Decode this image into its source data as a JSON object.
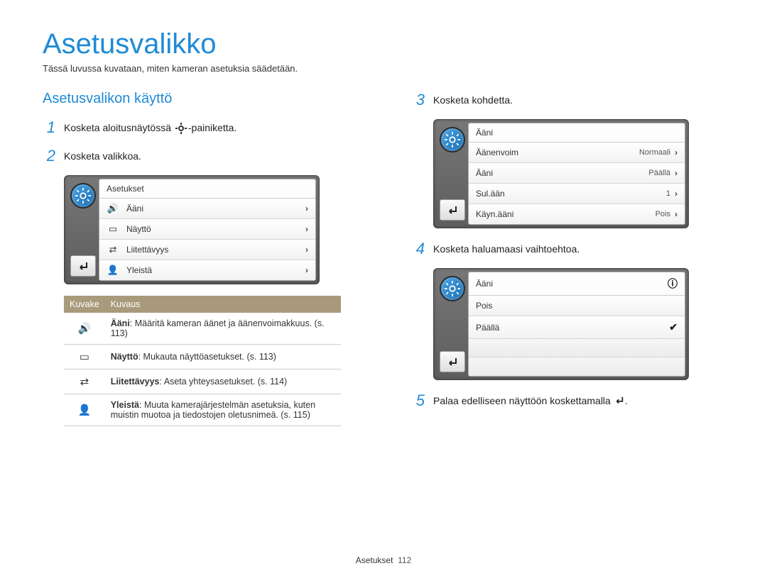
{
  "page": {
    "title": "Asetusvalikko",
    "subtitle": "Tässä luvussa kuvataan, miten kameran asetuksia säädetään."
  },
  "section_title": "Asetusvalikon käyttö",
  "steps": {
    "s1_prefix": "Kosketa aloitusnäytössä ",
    "s1_suffix": "-painiketta.",
    "s2": "Kosketa valikkoa.",
    "s3": "Kosketa kohdetta.",
    "s4": "Kosketa haluamaasi vaihtoehtoa.",
    "s5_prefix": "Palaa edelliseen näyttöön koskettamalla ",
    "s5_suffix": "."
  },
  "screen1": {
    "header": "Asetukset",
    "rows": [
      {
        "icon": "sound-icon",
        "label": "Ääni"
      },
      {
        "icon": "display-icon",
        "label": "Näyttö"
      },
      {
        "icon": "connectivity-icon",
        "label": "Liitettävyys"
      },
      {
        "icon": "general-icon",
        "label": "Yleistä"
      }
    ]
  },
  "screen2": {
    "header": "Ääni",
    "rows": [
      {
        "label": "Äänenvoim",
        "value": "Normaali"
      },
      {
        "label": "Ääni",
        "value": "Päällä"
      },
      {
        "label": "Sul.ään",
        "value": "1"
      },
      {
        "label": "Käyn.ääni",
        "value": "Pois"
      }
    ]
  },
  "screen3": {
    "header": "Ääni",
    "rows": [
      {
        "label": "Pois",
        "selected": false
      },
      {
        "label": "Päällä",
        "selected": true
      }
    ]
  },
  "desc_table": {
    "head_icon": "Kuvake",
    "head_desc": "Kuvaus",
    "rows": [
      {
        "icon": "sound-icon",
        "bold": "Ääni",
        "text": ": Määritä kameran äänet ja äänenvoimakkuus. (s. 113)"
      },
      {
        "icon": "display-icon",
        "bold": "Näyttö",
        "text": ": Mukauta näyttöasetukset. (s. 113)"
      },
      {
        "icon": "connectivity-icon",
        "bold": "Liitettävyys",
        "text": ": Aseta yhteysasetukset. (s. 114)"
      },
      {
        "icon": "general-icon",
        "bold": "Yleistä",
        "text": ": Muuta kamerajärjestelmän asetuksia, kuten muistin muotoa ja tiedostojen oletusnimeä. (s. 115)"
      }
    ]
  },
  "footer": {
    "label": "Asetukset",
    "page_number": "112"
  }
}
